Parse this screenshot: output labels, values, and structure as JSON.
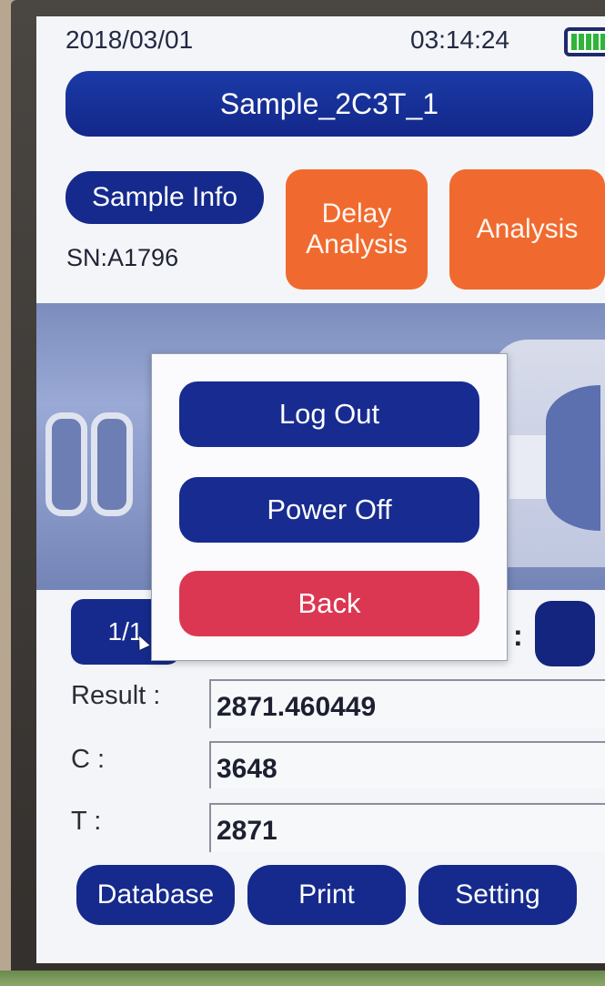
{
  "status_bar": {
    "date": "2018/03/01",
    "time": "03:14:24",
    "battery_icon": "battery-icon"
  },
  "header": {
    "title": "Sample_2C3T_1"
  },
  "sample": {
    "info_button": "Sample Info",
    "sn": "SN:A1796"
  },
  "actions": {
    "delay_analysis_line1": "Delay",
    "delay_analysis_line2": "Analysis",
    "analysis": "Analysis"
  },
  "pager": {
    "page": "1/1",
    "colon": ":"
  },
  "results": {
    "result_label": "Result :",
    "result_value": "2871.460449",
    "c_label": "C :",
    "c_value": "3648",
    "t_label": "T :",
    "t_value": "2871"
  },
  "toolbar": {
    "database": "Database",
    "print": "Print",
    "setting": "Setting"
  },
  "modal": {
    "log_out": "Log Out",
    "power_off": "Power Off",
    "back": "Back"
  },
  "colors": {
    "primary_blue": "#152a8c",
    "orange": "#f06a2f",
    "back_red": "#dc3752",
    "battery_green": "#2fb53a"
  }
}
